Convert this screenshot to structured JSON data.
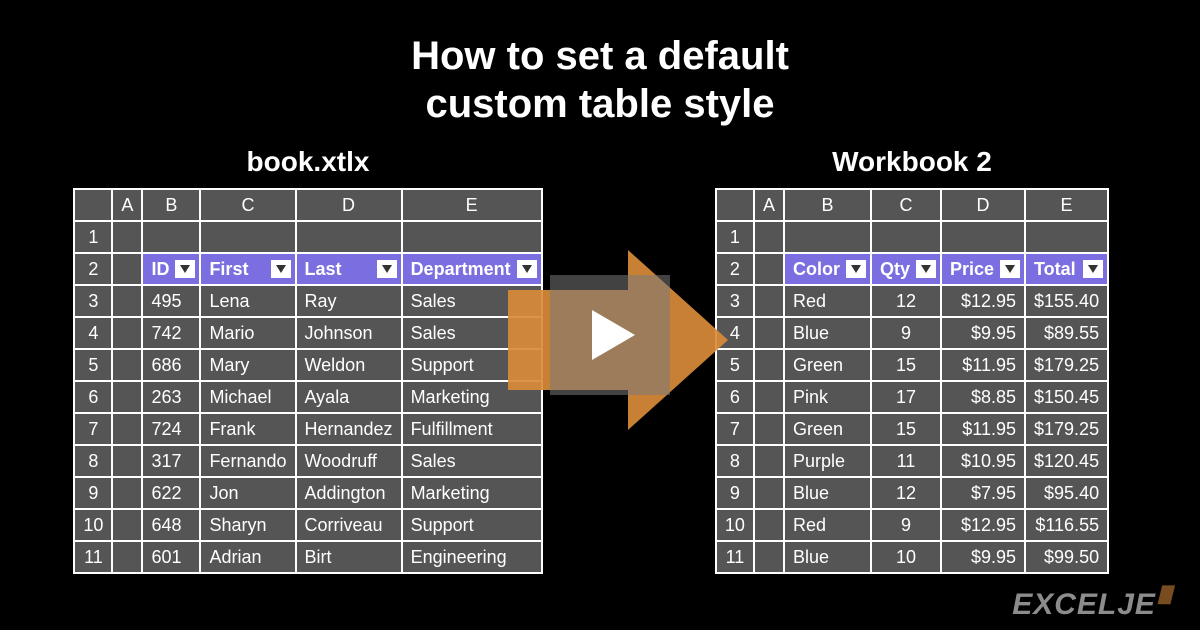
{
  "title_line1": "How to set a default",
  "title_line2": "custom table style",
  "brand_text": "EXCELJE",
  "left": {
    "caption": "book.xtlx",
    "col_letters": [
      "A",
      "B",
      "C",
      "D",
      "E"
    ],
    "headers": [
      "ID",
      "First",
      "Last",
      "Department"
    ],
    "rows": [
      {
        "n": "3",
        "id": "495",
        "first": "Lena",
        "last": "Ray",
        "dept": "Sales"
      },
      {
        "n": "4",
        "id": "742",
        "first": "Mario",
        "last": "Johnson",
        "dept": "Sales"
      },
      {
        "n": "5",
        "id": "686",
        "first": "Mary",
        "last": "Weldon",
        "dept": "Support"
      },
      {
        "n": "6",
        "id": "263",
        "first": "Michael",
        "last": "Ayala",
        "dept": "Marketing"
      },
      {
        "n": "7",
        "id": "724",
        "first": "Frank",
        "last": "Hernandez",
        "dept": "Fulfillment"
      },
      {
        "n": "8",
        "id": "317",
        "first": "Fernando",
        "last": "Woodruff",
        "dept": "Sales"
      },
      {
        "n": "9",
        "id": "622",
        "first": "Jon",
        "last": "Addington",
        "dept": "Marketing"
      },
      {
        "n": "10",
        "id": "648",
        "first": "Sharyn",
        "last": "Corriveau",
        "dept": "Support"
      },
      {
        "n": "11",
        "id": "601",
        "first": "Adrian",
        "last": "Birt",
        "dept": "Engineering"
      }
    ],
    "row1": "1",
    "row2": "2"
  },
  "right": {
    "caption": "Workbook 2",
    "col_letters": [
      "A",
      "B",
      "C",
      "D",
      "E"
    ],
    "headers": [
      "Color",
      "Qty",
      "Price",
      "Total"
    ],
    "rows": [
      {
        "n": "3",
        "color": "Red",
        "qty": "12",
        "price": "$12.95",
        "total": "$155.40"
      },
      {
        "n": "4",
        "color": "Blue",
        "qty": "9",
        "price": "$9.95",
        "total": "$89.55"
      },
      {
        "n": "5",
        "color": "Green",
        "qty": "15",
        "price": "$11.95",
        "total": "$179.25"
      },
      {
        "n": "6",
        "color": "Pink",
        "qty": "17",
        "price": "$8.85",
        "total": "$150.45"
      },
      {
        "n": "7",
        "color": "Green",
        "qty": "15",
        "price": "$11.95",
        "total": "$179.25"
      },
      {
        "n": "8",
        "color": "Purple",
        "qty": "11",
        "price": "$10.95",
        "total": "$120.45"
      },
      {
        "n": "9",
        "color": "Blue",
        "qty": "12",
        "price": "$7.95",
        "total": "$95.40"
      },
      {
        "n": "10",
        "color": "Red",
        "qty": "9",
        "price": "$12.95",
        "total": "$116.55"
      },
      {
        "n": "11",
        "color": "Blue",
        "qty": "10",
        "price": "$9.95",
        "total": "$99.50"
      }
    ],
    "row1": "1",
    "row2": "2"
  }
}
